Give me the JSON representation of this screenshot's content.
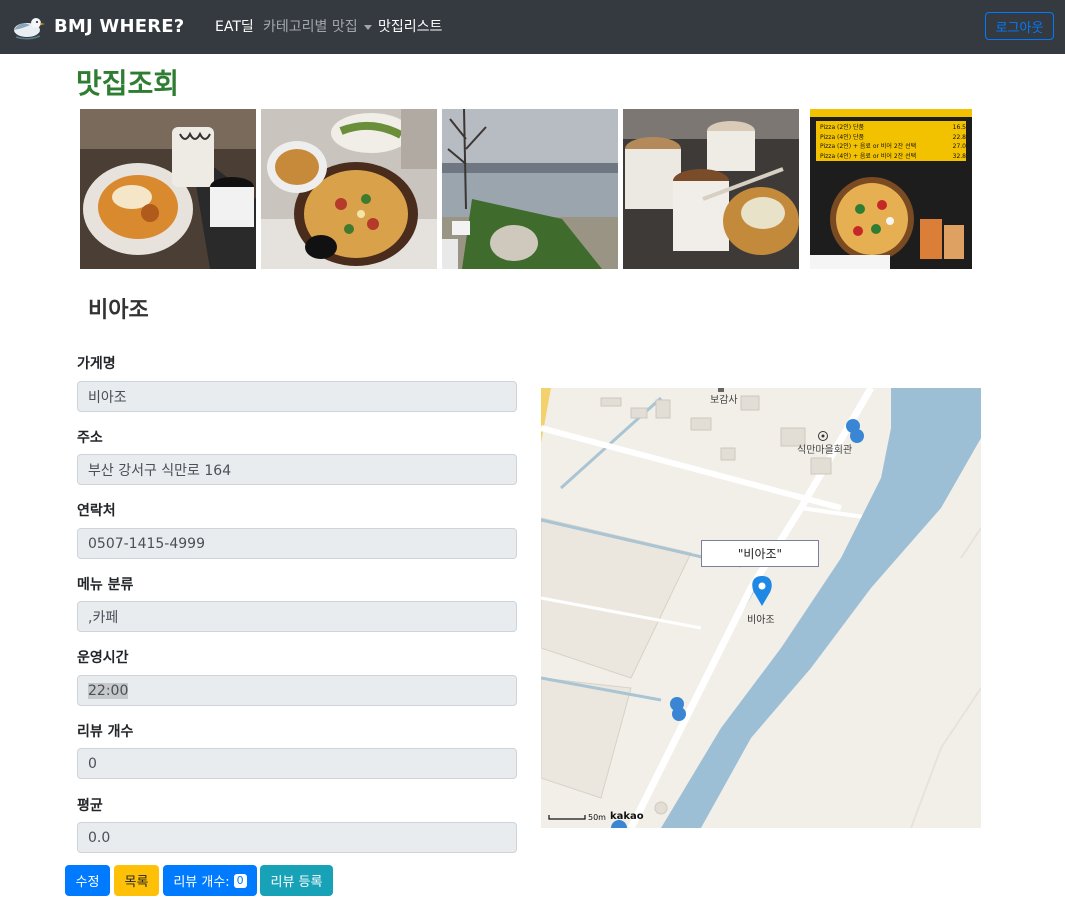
{
  "navbar": {
    "brand": "BMJ WHERE?",
    "items": [
      {
        "label": "EAT딜"
      },
      {
        "label": "카테고리별 맛집"
      },
      {
        "label": "맛집리스트"
      }
    ],
    "logout": "로그아웃"
  },
  "page_title": "맛집조회",
  "menu_board": {
    "rows": [
      {
        "label": "Pizza (2인) 단품",
        "price": "16.5"
      },
      {
        "label": "Pizza (4인) 단품",
        "price": "22.8"
      },
      {
        "label": "Pizza (2인) + 음료 or 비어 2잔 선택",
        "price": "27.0"
      },
      {
        "label": "Pizza (4인) + 음료 or 비어 2잔 선택",
        "price": "32.8"
      }
    ]
  },
  "store_name": "비아조",
  "fields": {
    "name": {
      "label": "가게명",
      "value": "비아조"
    },
    "address": {
      "label": "주소",
      "value": "부산 강서구 식만로 164"
    },
    "phone": {
      "label": "연락처",
      "value": "0507-1415-4999"
    },
    "category": {
      "label": "메뉴 분류",
      "value": ",카페"
    },
    "hours": {
      "label": "운영시간",
      "value": "22:00"
    },
    "review_count": {
      "label": "리뷰 개수",
      "value": "0"
    },
    "average": {
      "label": "평균",
      "value": "0.0"
    }
  },
  "map": {
    "labels": {
      "temple": "보감사",
      "hall": "식만마을회관",
      "marker": "비아조"
    },
    "infowindow": "\"비아조\"",
    "scale": "50m",
    "brand": "kakao"
  },
  "buttons": {
    "edit": "수정",
    "list": "목록",
    "reviews_label": "리뷰 개수:",
    "reviews_count": "0",
    "write_review": "리뷰 등록"
  },
  "colors": {
    "navbar": "#343a40",
    "title_green": "#2e7d32",
    "primary": "#007bff",
    "warning": "#ffc107",
    "info": "#17a2b8",
    "river": "#9dbfd6"
  }
}
